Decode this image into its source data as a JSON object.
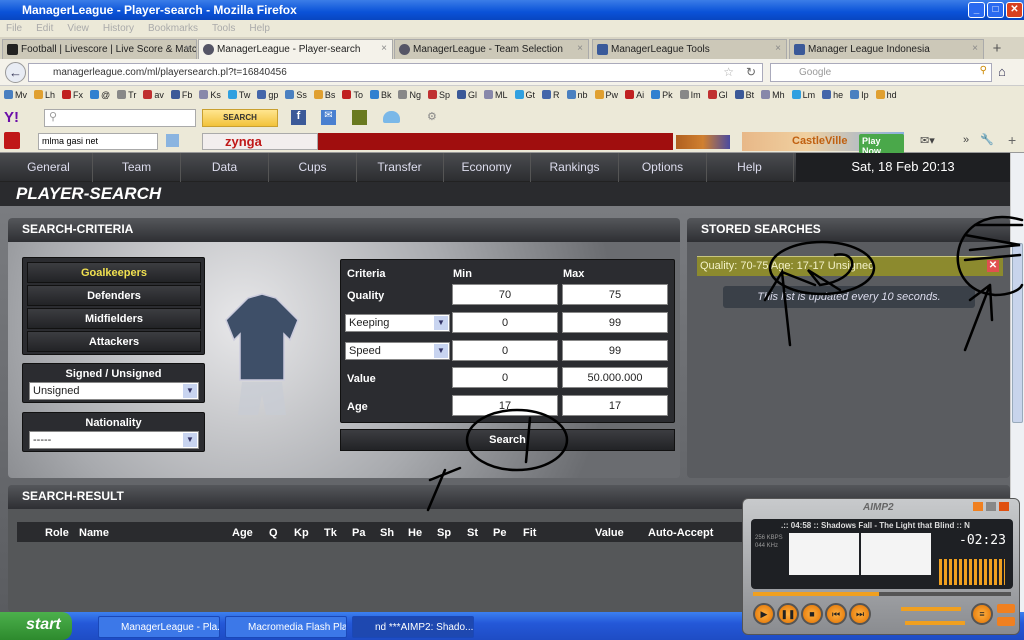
{
  "window": {
    "title": "ManagerLeague - Player-search - Mozilla Firefox"
  },
  "menu": [
    "File",
    "Edit",
    "View",
    "History",
    "Bookmarks",
    "Tools",
    "Help"
  ],
  "tabs": [
    {
      "label": "Football | Livescore | Live Score & Match...",
      "active": false
    },
    {
      "label": "ManagerLeague - Player-search",
      "active": true
    },
    {
      "label": "ManagerLeague - Team Selection",
      "active": false
    },
    {
      "label": "ManagerLeague Tools",
      "active": false
    },
    {
      "label": "Manager League Indonesia",
      "active": false
    }
  ],
  "nav": {
    "url": "managerleague.com/ml/playersearch.pl?t=16840456",
    "search_placeholder": "Google"
  },
  "bookmarks": [
    "Mv",
    "Lh",
    "Fx",
    "@",
    "Tr",
    "av",
    "Fb",
    "Ks",
    "Tw",
    "gp",
    "Ss",
    "Bs",
    "To",
    "Bk",
    "Ng",
    "Sp",
    "Gl",
    "ML",
    "Gt",
    "R",
    "nb",
    "Pw",
    "Ai",
    "Pk",
    "Im",
    "Gl",
    "Bt",
    "Mh",
    "Lm",
    "he",
    "Ip",
    "hd"
  ],
  "yahoo": {
    "search_button": "SEARCH"
  },
  "zynga": {
    "field_value": "mlma gasi net",
    "brand": "zynga",
    "ad": "CastleVille",
    "play_now": "Play Now"
  },
  "game_nav": {
    "items": [
      "General",
      "Team",
      "Data",
      "Cups",
      "Transfer",
      "Economy",
      "Rankings",
      "Options",
      "Help"
    ],
    "datetime": "Sat, 18 Feb 20:13"
  },
  "page_title": "PLAYER-SEARCH",
  "criteria": {
    "title": "SEARCH-CRITERIA",
    "positions": [
      "Goalkeepers",
      "Defenders",
      "Midfielders",
      "Attackers"
    ],
    "selected_position": "Goalkeepers",
    "signed_label": "Signed / Unsigned",
    "signed_value": "Unsigned",
    "nationality_label": "Nationality",
    "nationality_value": "-----",
    "headers": {
      "criteria": "Criteria",
      "min": "Min",
      "max": "Max"
    },
    "rows": [
      {
        "label": "Quality",
        "min": "70",
        "max": "75"
      },
      {
        "label": "Keeping",
        "min": "0",
        "max": "99",
        "select": true
      },
      {
        "label": "Speed",
        "min": "0",
        "max": "99",
        "select": true
      },
      {
        "label": "Value",
        "min": "0",
        "max": "50.000.000"
      },
      {
        "label": "Age",
        "min": "17",
        "max": "17"
      }
    ],
    "search_button": "Search"
  },
  "stored": {
    "title": "STORED SEARCHES",
    "entry": "Quality: 70-75 Age: 17-17 Unsigned",
    "info": "This list is updated every 10 seconds.",
    "highlight": "#8c8a2e"
  },
  "results": {
    "title": "SEARCH-RESULT",
    "columns": [
      "Role",
      "Name",
      "Age",
      "Q",
      "Kp",
      "Tk",
      "Pa",
      "Sh",
      "He",
      "Sp",
      "St",
      "Pe",
      "Fit",
      "Value",
      "Auto-Accept"
    ]
  },
  "taskbar": {
    "start": "start",
    "tasks": [
      "ManagerLeague - Pla...",
      "Macromedia Flash Pla...",
      "nd ***AIMP2: Shado..."
    ]
  },
  "aimp": {
    "logo": "AIMP2",
    "track": ".:: 04:58 :: Shadows Fall - The Light that Blind :: N",
    "time": "-02:23",
    "bitrate": "256 KBPS",
    "freq": "044 KHz",
    "progress": 0.49
  }
}
